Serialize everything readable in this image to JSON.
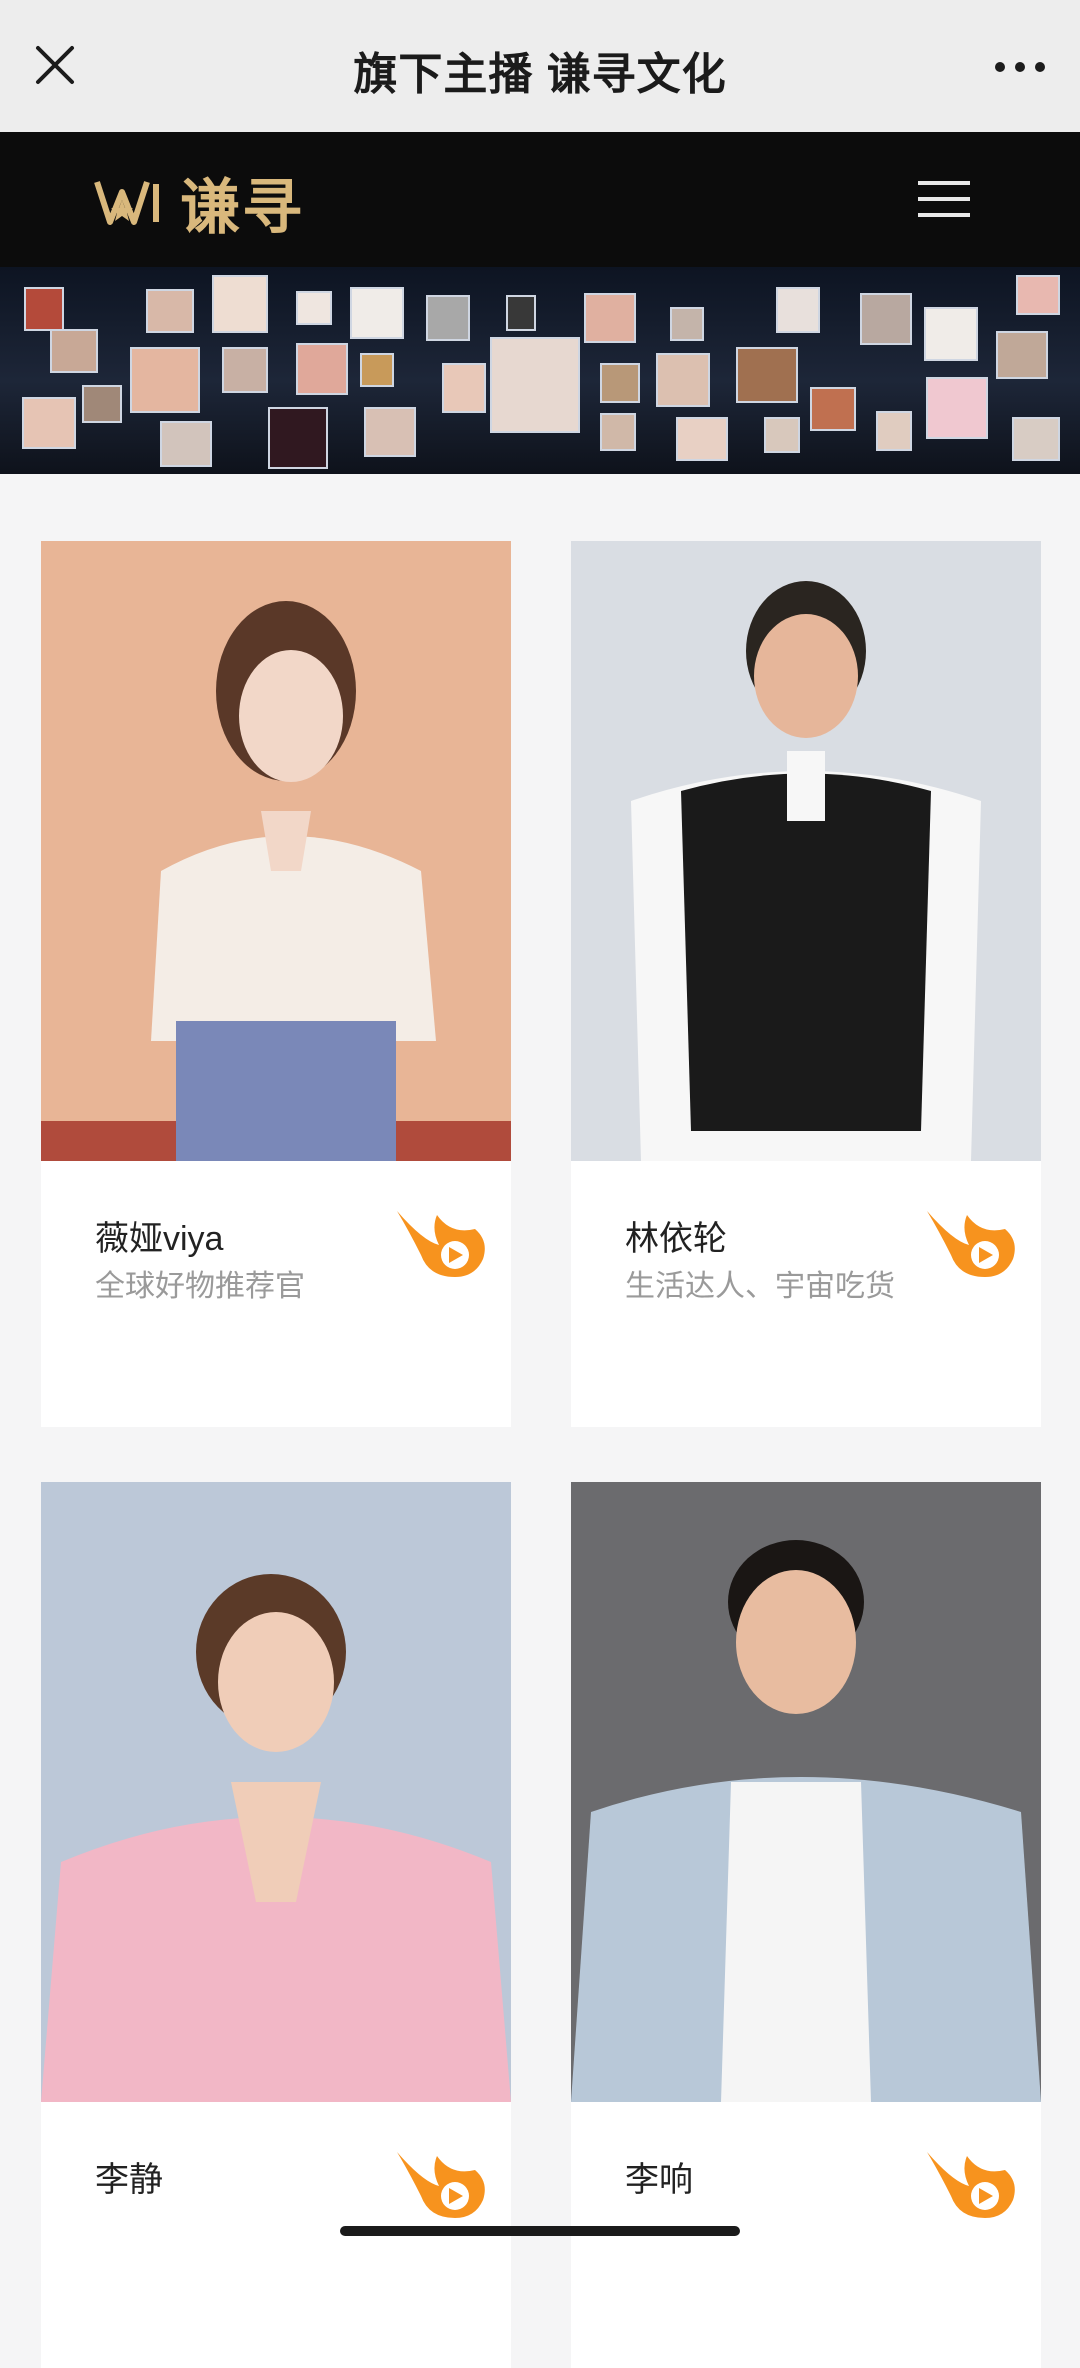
{
  "nav": {
    "title": "旗下主播 谦寻文化",
    "close_icon": "close-icon",
    "more_icon": "more-dots-icon"
  },
  "brand": {
    "logo_text": "谦寻",
    "logo_color": "#d9b87c",
    "menu_icon": "hamburger-menu-icon"
  },
  "banner": {
    "description_icon": "anchor-collage-image"
  },
  "anchors": [
    {
      "name": "薇娅viya",
      "desc": "全球好物推荐官",
      "icon": "flame-icon"
    },
    {
      "name": "林依轮",
      "desc": "生活达人、宇宙吃货",
      "icon": "flame-icon"
    },
    {
      "name": "李静",
      "desc": "",
      "icon": "flame-icon"
    },
    {
      "name": "李响",
      "desc": "",
      "icon": "flame-icon"
    }
  ],
  "colors": {
    "accent_orange": "#f7931e",
    "nav_bg": "#ededed",
    "brand_bg": "#0c0c0c"
  }
}
